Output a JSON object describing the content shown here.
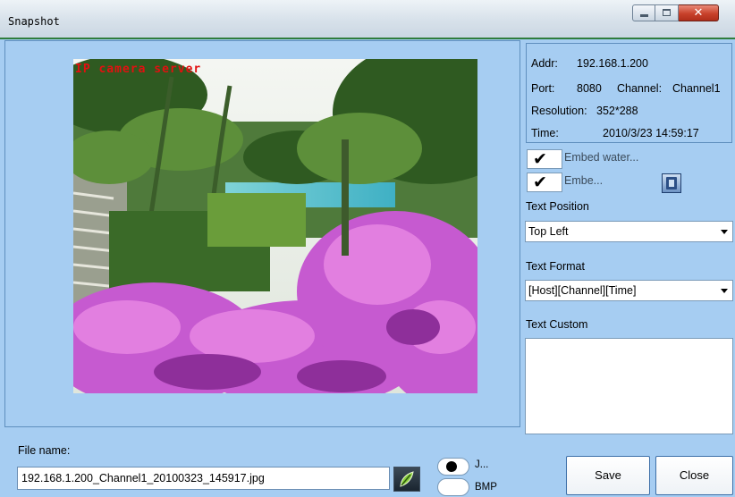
{
  "window": {
    "title": "Snapshot"
  },
  "preview": {
    "watermark_text": "IP camera server"
  },
  "info": {
    "addr_label": "Addr:",
    "addr_value": "192.168.1.200",
    "port_label": "Port:",
    "port_value": "8080",
    "channel_label": "Channel:",
    "channel_value": "Channel1",
    "resolution_label": "Resolution:",
    "resolution_value": "352*288",
    "time_label": "Time:",
    "time_value": "2010/3/23 14:59:17"
  },
  "options": {
    "embed_water_label": "Embed water...",
    "embed_water_checked": true,
    "embed_second_label": "Embe...",
    "embed_second_checked": true,
    "text_position_label": "Text Position",
    "text_position_value": "Top Left",
    "text_format_label": "Text Format",
    "text_format_value": "[Host][Channel][Time]",
    "text_custom_label": "Text Custom",
    "text_custom_value": ""
  },
  "file": {
    "label": "File name:",
    "value": "192.168.1.200_Channel1_20100323_145917.jpg"
  },
  "format": {
    "jpg_label": "J...",
    "bmp_label": "BMP",
    "selected": "jpg"
  },
  "buttons": {
    "save_label": "Save",
    "close_label": "Close"
  },
  "colors": {
    "window_bg": "#a6cdf2",
    "watermark": "#e21010",
    "accent_line": "#2f7d3c"
  }
}
